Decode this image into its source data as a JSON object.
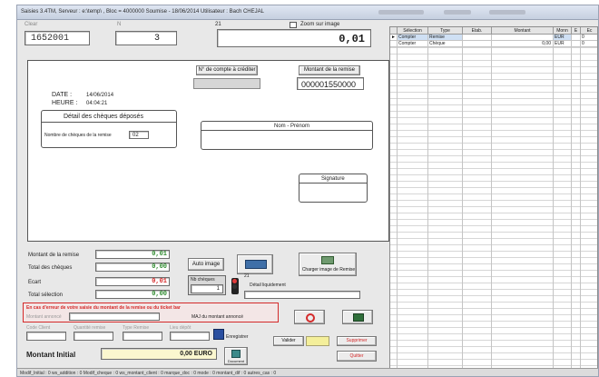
{
  "window": {
    "title": "Saisies 3.4TM, Serveur : e:\\temp\\ , Bloc = 4000000 Soumise - 18/06/2014 Utilisateur : Bach CHEJAL"
  },
  "top": {
    "left_label": "Clear ",
    "mid_label": "N",
    "right_label": "21",
    "checkbox_label": "Zoom sur image",
    "id_value": "1652001",
    "count_value": "3",
    "amount_value": "0,01"
  },
  "paper": {
    "account_button": "N° de compte à créditer",
    "account_value": "",
    "amount_header": "Montant de la remise",
    "amount_value": "000001550000",
    "date_label": "DATE :",
    "date_value": "14/06/2014",
    "time_label": "HEURE :",
    "time_value": "04:04:21",
    "detail_title": "Détail des chèques déposés",
    "detail_count_label": "Nombre de chèques de la remise",
    "detail_count_value": "02",
    "name_label": "Nom - Prénom",
    "signature_label": "Signature"
  },
  "totals": {
    "remise_label": "Montant de la remise",
    "remise_value": "0,01",
    "cheques_label": "Total des chèques",
    "cheques_value": "0,00",
    "ecart_label": "Ecart",
    "ecart_value": "0,01",
    "selection_label": "Total sélection",
    "selection_value": "0,00"
  },
  "controls": {
    "auto_image": "Auto image",
    "nb_cheques_label": "Nb chèques",
    "nb_cheques_value": "1",
    "detail_label": "Détail liquidement",
    "charger_label": "Charger image de Remise",
    "counter_label": "21"
  },
  "warning": {
    "text": "En cas d'erreur de votre saisie du montant de la remise ou du ticket bar",
    "field_label": "Montant annoncé",
    "maj_button": "MAJ du montant annoncé"
  },
  "bottom": {
    "col1": "Code Client",
    "col2": "Quantité remise",
    "col3": "Type Remise",
    "col4": "Lieu dépôt",
    "enregistrer": "Enregistrer",
    "valider": "Valider",
    "supprimer": "Supprimer",
    "quitter": "Quitter",
    "document_label": "Document",
    "initial_label": "Montant Initial",
    "initial_value": "0,00 EURO"
  },
  "grid": {
    "headers": [
      "Sélection",
      "Type",
      "Etab.",
      "Montant",
      "Monn",
      "E",
      "Ec"
    ],
    "rows": [
      [
        "Compter",
        "Remise",
        "",
        "",
        "EUR",
        "",
        "0"
      ],
      [
        "Compter",
        "Chèque",
        "",
        "0,00",
        "EUR",
        "",
        "0"
      ]
    ]
  },
  "statusbar": {
    "text": "Modif_Initial : 0 ws_addition : 0 Modif_cheque : 0 ws_montant_client : 0 marque_doc : 0 mode : 0 montant_dif : 0 autres_cas : 0"
  },
  "colors": {
    "warning_red": "#d42a2a",
    "value_green": "#2c8a2c",
    "highlight_yellow": "#fbf7cf"
  }
}
